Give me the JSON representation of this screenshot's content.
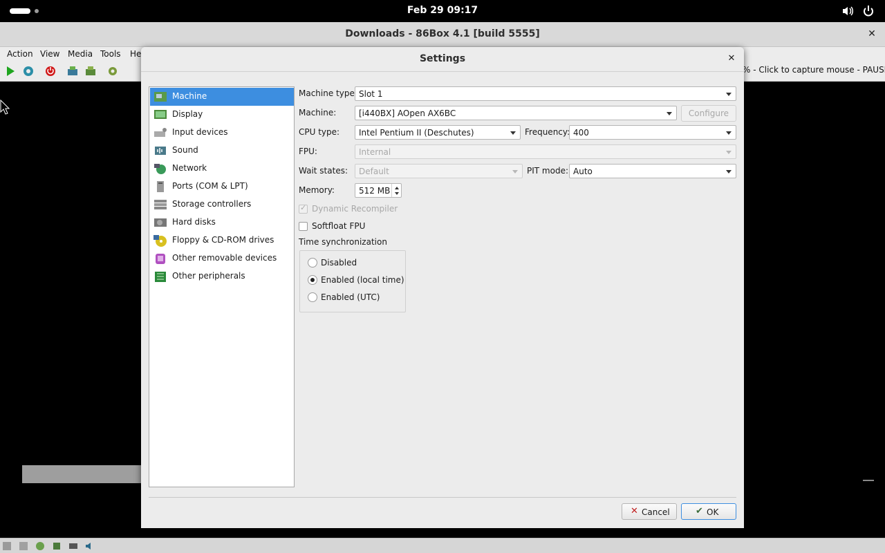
{
  "system": {
    "clock": "Feb 29  09:17",
    "icons": [
      "activities-pill",
      "volume-icon",
      "power-icon"
    ]
  },
  "main_window": {
    "title": "Downloads - 86Box 4.1 [build 5555]",
    "menu": [
      "Action",
      "View",
      "Media",
      "Tools",
      "He"
    ],
    "status_message": "% - Click to capture mouse - PAUSED",
    "toolbar_icons": [
      "play-icon",
      "reset-icon",
      "power-off-icon",
      "ctrl-alt-del-icon",
      "ctrl-alt-esc-icon",
      "settings-icon"
    ]
  },
  "dialog": {
    "title": "Settings",
    "categories": [
      {
        "label": "Machine",
        "icon": "machine-icon",
        "selected": true
      },
      {
        "label": "Display",
        "icon": "display-icon"
      },
      {
        "label": "Input devices",
        "icon": "input-devices-icon"
      },
      {
        "label": "Sound",
        "icon": "sound-icon"
      },
      {
        "label": "Network",
        "icon": "network-icon"
      },
      {
        "label": "Ports (COM & LPT)",
        "icon": "ports-icon"
      },
      {
        "label": "Storage controllers",
        "icon": "storage-controllers-icon"
      },
      {
        "label": "Hard disks",
        "icon": "hard-disk-icon"
      },
      {
        "label": "Floppy & CD-ROM drives",
        "icon": "floppy-cdrom-icon"
      },
      {
        "label": "Other removable devices",
        "icon": "removable-devices-icon"
      },
      {
        "label": "Other peripherals",
        "icon": "peripherals-icon"
      }
    ],
    "machine": {
      "machine_type_label": "Machine type:",
      "machine_type_value": "Slot 1",
      "machine_label": "Machine:",
      "machine_value": "[i440BX] AOpen AX6BC",
      "configure_label": "Configure",
      "cpu_type_label": "CPU type:",
      "cpu_type_value": "Intel Pentium II (Deschutes)",
      "frequency_label": "Frequency:",
      "frequency_value": "400",
      "fpu_label": "FPU:",
      "fpu_value": "Internal",
      "wait_states_label": "Wait states:",
      "wait_states_value": "Default",
      "pit_mode_label": "PIT mode:",
      "pit_mode_value": "Auto",
      "memory_label": "Memory:",
      "memory_value": "512 MB",
      "dynamic_recompiler_label": "Dynamic Recompiler",
      "dynamic_recompiler_checked": true,
      "softfloat_label": "Softfloat FPU",
      "softfloat_checked": false,
      "time_sync_label": "Time synchronization",
      "time_sync_options": [
        "Disabled",
        "Enabled (local time)",
        "Enabled (UTC)"
      ],
      "time_sync_selected": "Enabled (local time)"
    },
    "buttons": {
      "cancel": "Cancel",
      "ok": "OK"
    }
  }
}
